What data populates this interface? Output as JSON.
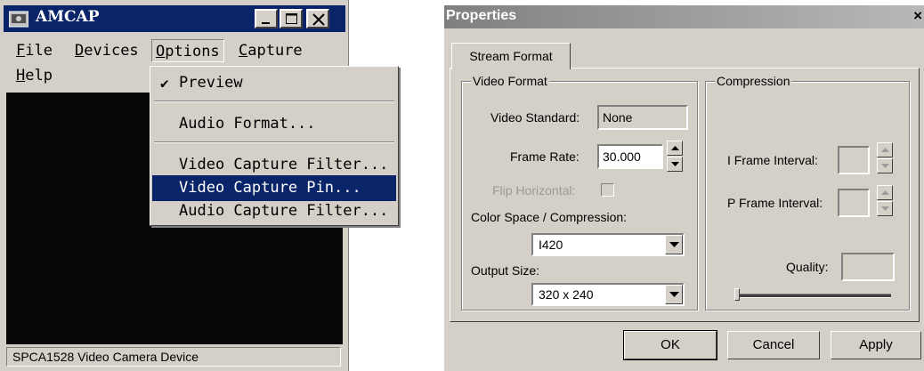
{
  "amcap": {
    "title": "AMCAP",
    "menu": {
      "file": {
        "underline": "F",
        "rest": "ile"
      },
      "devices": {
        "underline": "D",
        "rest": "evices"
      },
      "options": {
        "underline": "O",
        "rest": "ptions"
      },
      "capture": {
        "underline": "C",
        "rest": "apture"
      },
      "help": {
        "underline": "H",
        "rest": "elp"
      }
    },
    "options_menu": {
      "check_glyph": "✔",
      "preview": "Preview",
      "audio_format": "Audio Format...",
      "video_capture_filter": "Video Capture Filter...",
      "video_capture_pin": "Video Capture Pin...",
      "audio_capture_filter": "Audio Capture Filter..."
    },
    "status": "SPCA1528 Video Camera Device"
  },
  "properties": {
    "title": "Properties",
    "close": "×",
    "tab": "Stream Format",
    "video_format": {
      "group": "Video Format",
      "video_standard_label": "Video Standard:",
      "video_standard_value": "None",
      "frame_rate_label": "Frame Rate:",
      "frame_rate_value": "30.000",
      "flip_label": "Flip Horizontal:",
      "color_space_label": "Color Space / Compression:",
      "color_space_value": "I420",
      "output_size_label": "Output Size:",
      "output_size_value": "320 x 240"
    },
    "compression": {
      "group": "Compression",
      "i_frame_label": "I Frame Interval:",
      "p_frame_label": "P Frame Interval:",
      "quality_label": "Quality:"
    },
    "buttons": {
      "ok": "OK",
      "cancel": "Cancel",
      "apply": "Apply"
    }
  },
  "colors": {
    "highlight": "#0a246a",
    "face": "#d4d0c8",
    "inactive_title": "#808080"
  }
}
